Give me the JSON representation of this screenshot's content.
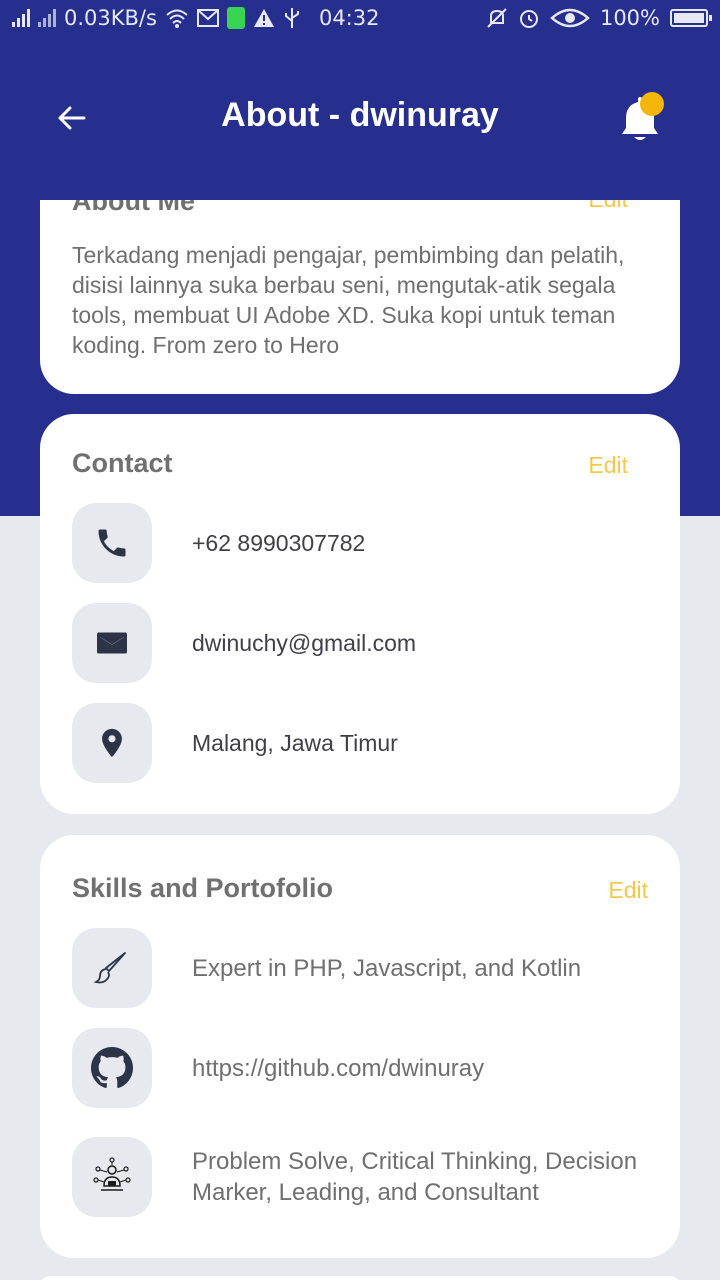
{
  "status_bar": {
    "network_speed": "0.03KB/s",
    "time": "04:32",
    "battery": "100%",
    "icons": [
      "signal-icon",
      "signal-icon-2",
      "wifi-icon",
      "gmail-icon",
      "battery-charging-icon",
      "warning-icon",
      "usb-icon",
      "mute-icon",
      "alarm-icon",
      "eye-icon",
      "battery-icon"
    ]
  },
  "header": {
    "title": "About - dwinuray",
    "back_icon": "arrow-left-icon",
    "notification_icon": "bell-icon",
    "accent_color": "#262f8e",
    "badge_color": "#f5b60b"
  },
  "about": {
    "title": "About Me",
    "edit_label": "Edit",
    "text": "Terkadang menjadi pengajar, pembimbing dan pelatih, disisi lainnya suka berbau seni, mengutak-atik segala tools, membuat UI Adobe XD. Suka kopi untuk teman koding. From zero to Hero"
  },
  "contact": {
    "title": "Contact",
    "edit_label": "Edit",
    "items": [
      {
        "icon": "phone-icon",
        "text": "+62 8990307782"
      },
      {
        "icon": "mail-icon",
        "text": "dwinuchy@gmail.com"
      },
      {
        "icon": "location-pin-icon",
        "text": "Malang, Jawa Timur"
      }
    ]
  },
  "skills": {
    "title": "Skills and Portofolio",
    "edit_label": "Edit",
    "items": [
      {
        "icon": "paint-brush-icon",
        "text": "Expert in PHP, Javascript, and Kotlin"
      },
      {
        "icon": "github-icon",
        "text": "https://github.com/dwinuray"
      },
      {
        "icon": "network-person-icon",
        "text": "Problem Solve, Critical Thinking, Decision Marker, Leading, and Consultant"
      }
    ]
  },
  "colors": {
    "edit": "#f2c94c",
    "icon_bg": "#e8e9ee",
    "icon_fg": "#2d3448"
  }
}
